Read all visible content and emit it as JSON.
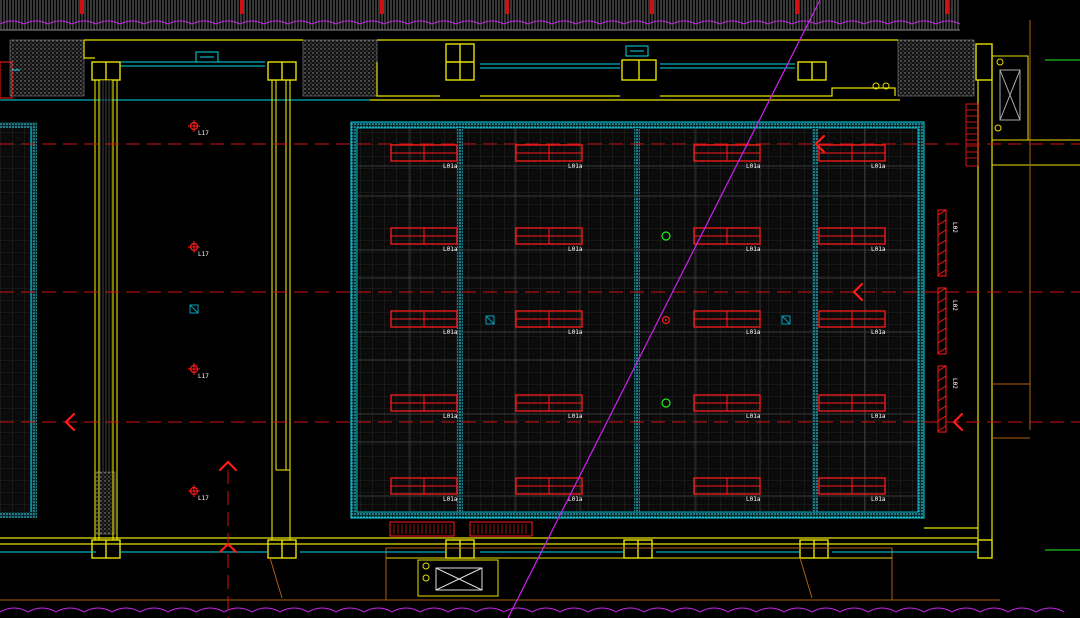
{
  "drawing": {
    "colors": {
      "background": "#000000",
      "wall": "#e8e000",
      "cyan": "#00d8e8",
      "grid": "#7a7a7a",
      "fixture": "#ff1a1a",
      "axis": "#d01010",
      "magenta": "#cc22ee",
      "green": "#22ee22",
      "orange": "#b06010",
      "hatch": "#9a9a9a"
    },
    "ceiling_fixture_label": "L01a",
    "downlight_label": "L17",
    "wall_light_label": "L02",
    "section_markers": [
      "section-marker-left",
      "section-marker-right-top",
      "section-marker-right-bottom",
      "section-marker-up"
    ]
  }
}
